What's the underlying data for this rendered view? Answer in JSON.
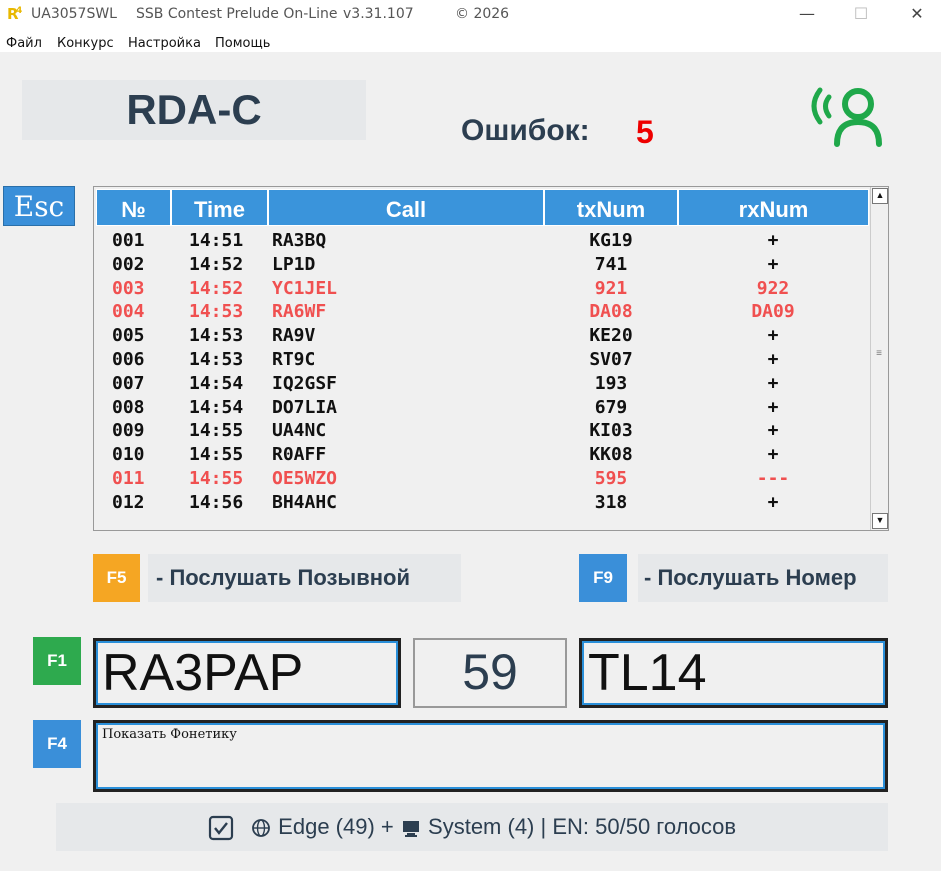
{
  "window": {
    "app_id": "UA3057SWL",
    "app_name": "SSB Contest Prelude On-Line",
    "version": "v3.31.107",
    "copyright": "© 2026",
    "minimize": "—",
    "maximize": "☐",
    "close": "✕"
  },
  "menu": [
    "Файл",
    "Конкурс",
    "Настройка",
    "Помощь"
  ],
  "contest": {
    "name": "RDA-C"
  },
  "errors": {
    "label": "Ошибок:",
    "count": "5"
  },
  "esc": "Esc",
  "log": {
    "headers": [
      "№",
      "Time",
      "Call",
      "txNum",
      "rxNum"
    ],
    "rows": [
      {
        "num": "001",
        "time": "14:51",
        "call": "RA3BQ",
        "tx": "KG19",
        "rx": "+",
        "error": false
      },
      {
        "num": "002",
        "time": "14:52",
        "call": "LP1D",
        "tx": "741",
        "rx": "+",
        "error": false
      },
      {
        "num": "003",
        "time": "14:52",
        "call": "YC1JEL",
        "tx": "921",
        "rx": "922",
        "error": true
      },
      {
        "num": "004",
        "time": "14:53",
        "call": "RA6WF",
        "tx": "DA08",
        "rx": "DA09",
        "error": true
      },
      {
        "num": "005",
        "time": "14:53",
        "call": "RA9V",
        "tx": "KE20",
        "rx": "+",
        "error": false
      },
      {
        "num": "006",
        "time": "14:53",
        "call": "RT9C",
        "tx": "SV07",
        "rx": "+",
        "error": false
      },
      {
        "num": "007",
        "time": "14:54",
        "call": "IQ2GSF",
        "tx": "193",
        "rx": "+",
        "error": false
      },
      {
        "num": "008",
        "time": "14:54",
        "call": "DO7LIA",
        "tx": "679",
        "rx": "+",
        "error": false
      },
      {
        "num": "009",
        "time": "14:55",
        "call": "UA4NC",
        "tx": "KI03",
        "rx": "+",
        "error": false
      },
      {
        "num": "010",
        "time": "14:55",
        "call": "R0AFF",
        "tx": "KK08",
        "rx": "+",
        "error": false
      },
      {
        "num": "011",
        "time": "14:55",
        "call": "OE5WZO",
        "tx": "595",
        "rx": "---",
        "error": true
      },
      {
        "num": "012",
        "time": "14:56",
        "call": "BH4AHC",
        "tx": "318",
        "rx": "+",
        "error": false
      }
    ]
  },
  "keys": {
    "f5": "F5",
    "f5_hint": "- Послушать Позывной",
    "f9": "F9",
    "f9_hint": "- Послушать Номер",
    "f1": "F1",
    "f4": "F4"
  },
  "entry": {
    "call": "RA3PAP",
    "rst": "59",
    "number": "TL14"
  },
  "phonetic": {
    "value": "Показать Фонетику"
  },
  "status": {
    "engine1": "Edge (49)",
    "plus": "+",
    "engine2": "System (4)",
    "voices": "| EN: 50/50 голосов"
  },
  "colors": {
    "accent_blue": "#3a8fd9",
    "error_red": "#f05050",
    "f5_orange": "#f5a623",
    "f1_green": "#2eaa4e",
    "signal_green": "#1fa84a"
  }
}
